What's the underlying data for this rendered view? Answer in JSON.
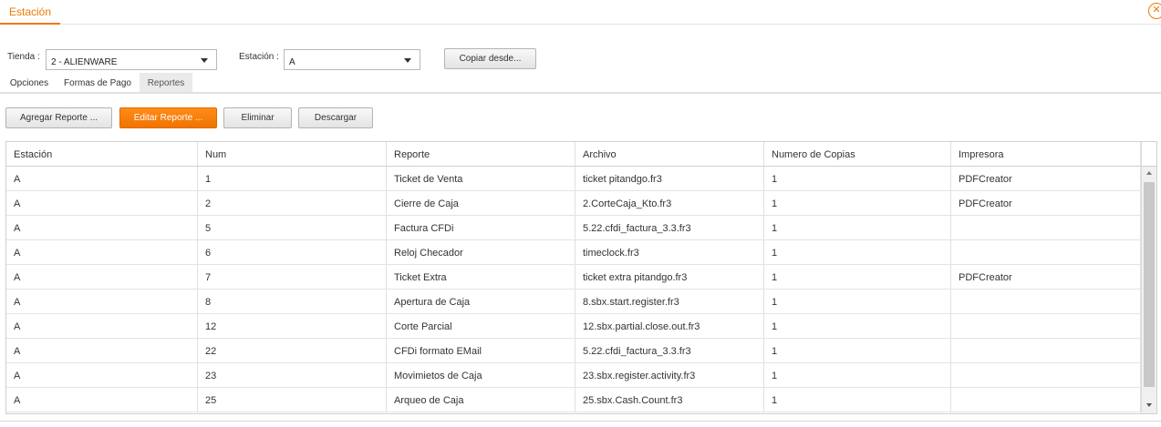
{
  "header": {
    "tab_label": "Estación",
    "close_glyph": "✕"
  },
  "filters": {
    "tienda_label": "Tienda :",
    "tienda_value": "2 - ALIENWARE",
    "estacion_label": "Estación :",
    "estacion_value": "A",
    "copy_button": "Copiar desde..."
  },
  "subtabs": [
    {
      "label": "Opciones"
    },
    {
      "label": "Formas de Pago"
    },
    {
      "label": "Reportes",
      "active": true
    }
  ],
  "toolbar": {
    "add": "Agregar Reporte ...",
    "edit": "Editar Reporte ...",
    "delete": "Eliminar",
    "download": "Descargar"
  },
  "table": {
    "columns": [
      "Estación",
      "Num",
      "Reporte",
      "Archivo",
      "Numero de Copias",
      "Impresora"
    ],
    "rows": [
      [
        "A",
        "1",
        "Ticket de Venta",
        "ticket pitandgo.fr3",
        "1",
        "PDFCreator"
      ],
      [
        "A",
        "2",
        "Cierre de Caja",
        "2.CorteCaja_Kto.fr3",
        "1",
        "PDFCreator"
      ],
      [
        "A",
        "5",
        "Factura CFDi",
        "5.22.cfdi_factura_3.3.fr3",
        "1",
        ""
      ],
      [
        "A",
        "6",
        "Reloj Checador",
        "timeclock.fr3",
        "1",
        ""
      ],
      [
        "A",
        "7",
        "Ticket Extra",
        "ticket extra pitandgo.fr3",
        "1",
        "PDFCreator"
      ],
      [
        "A",
        "8",
        "Apertura de Caja",
        "8.sbx.start.register.fr3",
        "1",
        ""
      ],
      [
        "A",
        "12",
        "Corte Parcial",
        "12.sbx.partial.close.out.fr3",
        "1",
        ""
      ],
      [
        "A",
        "22",
        "CFDi formato EMail",
        "5.22.cfdi_factura_3.3.fr3",
        "1",
        ""
      ],
      [
        "A",
        "23",
        "Movimietos de Caja",
        "23.sbx.register.activity.fr3",
        "1",
        ""
      ],
      [
        "A",
        "25",
        "Arqueo de Caja",
        "25.sbx.Cash.Count.fr3",
        "1",
        ""
      ]
    ]
  },
  "icons": {
    "close": "close-circle-icon",
    "dropdown": "chevron-down-icon",
    "scroll_up": "scroll-up-arrow-icon",
    "scroll_down": "scroll-down-arrow-icon"
  },
  "colors": {
    "accent": "#f07800"
  }
}
